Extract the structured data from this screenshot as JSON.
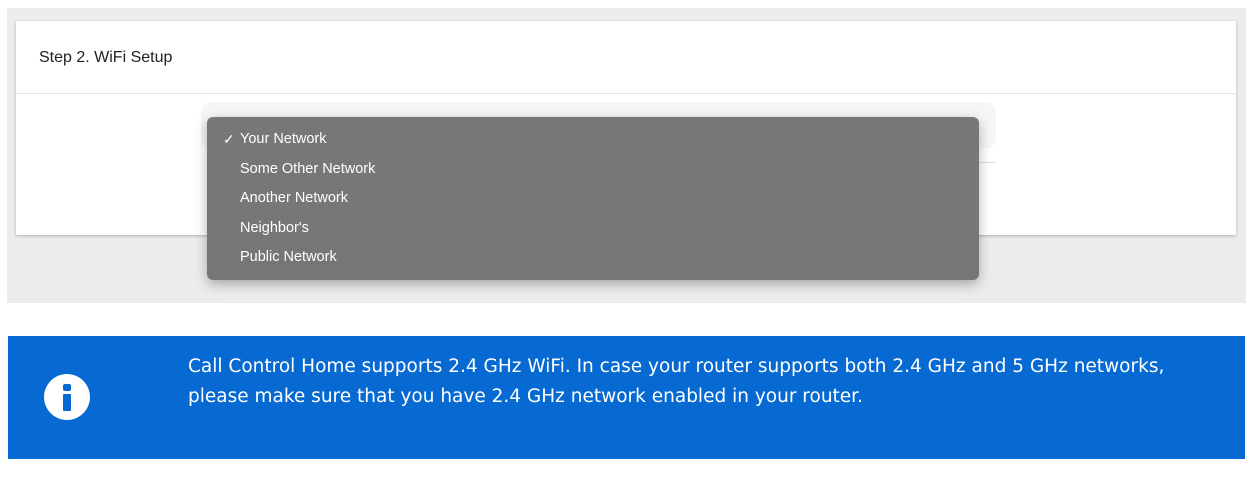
{
  "wifi_setup": {
    "title": "Step 2. WiFi Setup"
  },
  "network_dropdown": {
    "selected_check": "✓",
    "options": [
      {
        "label": "Your Network",
        "selected": true
      },
      {
        "label": "Some Other Network",
        "selected": false
      },
      {
        "label": "Another Network",
        "selected": false
      },
      {
        "label": "Neighbor's",
        "selected": false
      },
      {
        "label": "Public Network",
        "selected": false
      }
    ]
  },
  "info_banner": {
    "icon": "info-icon",
    "text": "Call Control Home supports 2.4 GHz WiFi. In case your router supports both 2.4 GHz and 5 GHz networks, please make sure that you have 2.4 GHz network enabled in your router.",
    "background_color": "#0769d2"
  }
}
